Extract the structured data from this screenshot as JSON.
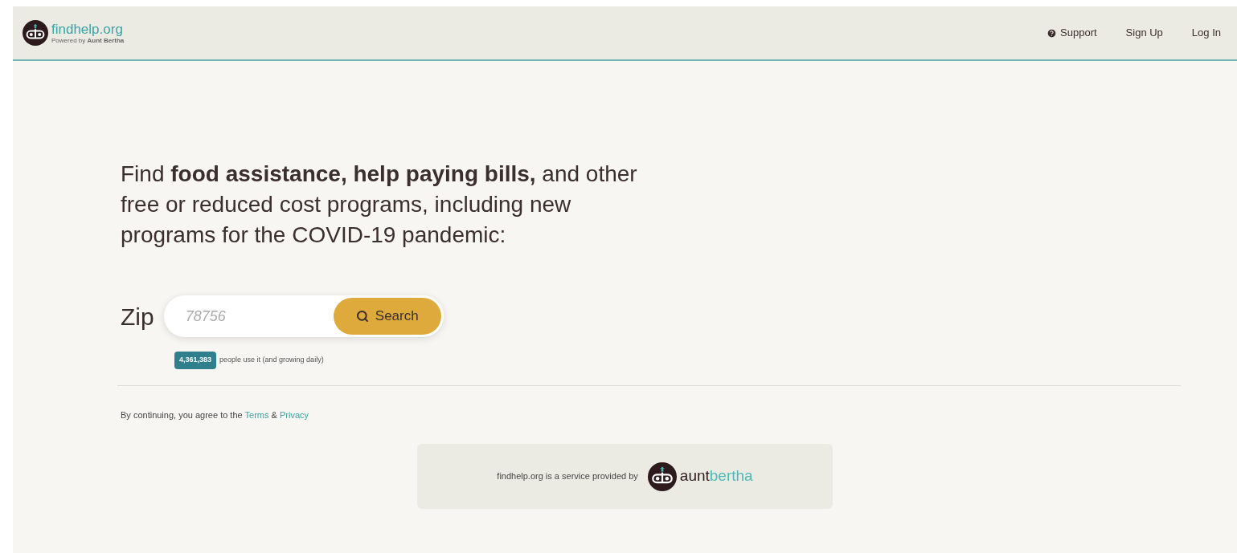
{
  "header": {
    "logo": {
      "name": "findhelp.org",
      "tagline": "Powered by **Aunt Bertha**"
    },
    "nav": [
      {
        "label": "Support",
        "icon": true
      },
      {
        "label": "Sign Up",
        "icon": false
      },
      {
        "label": "Log In",
        "icon": false
      }
    ]
  },
  "headline": "Find **food assistance, help paying bills,** and other free or reduced cost programs, including new programs for the COVID-19 pandemic:",
  "search": {
    "label": "Zip",
    "placeholder": "78756",
    "button": "Search"
  },
  "usage": {
    "count": "4,361,383",
    "text": "people use it (and growing daily)"
  },
  "consent": {
    "text": "By continuing, you agree to the",
    "terms": "Terms",
    "joiner": "&",
    "privacy": "Privacy"
  },
  "provider": {
    "text": "findhelp.org is a service provided by",
    "brand_first": "aunt",
    "brand_second": "bertha"
  }
}
